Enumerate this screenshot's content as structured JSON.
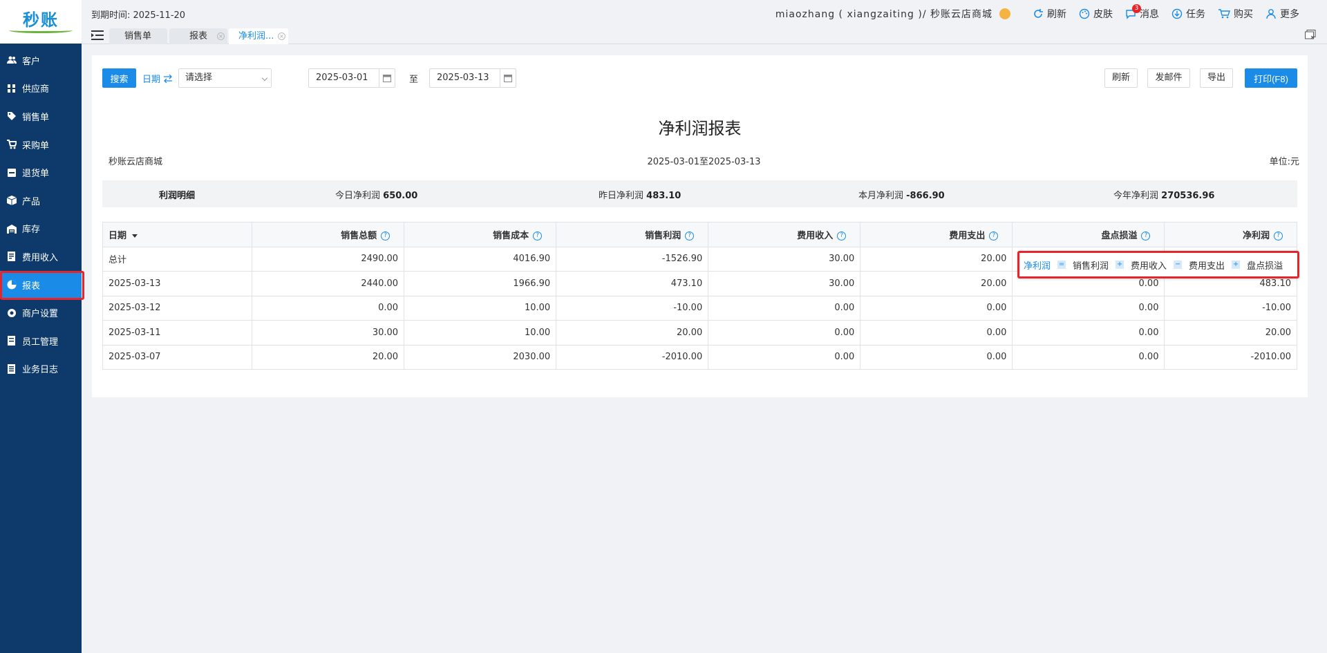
{
  "app": {
    "logo_text": "秒账",
    "expire_label": "到期时间: 2025-11-20",
    "user": "miaozhang ( xiangzaiting )/ 秒账云店商城",
    "toolbar": [
      {
        "label": "刷新",
        "icon": "refresh-icon"
      },
      {
        "label": "皮肤",
        "icon": "palette-icon"
      },
      {
        "label": "消息",
        "icon": "message-icon",
        "badge": "3"
      },
      {
        "label": "任务",
        "icon": "download-icon"
      },
      {
        "label": "购买",
        "icon": "cart-icon"
      },
      {
        "label": "更多",
        "icon": "user-icon"
      }
    ]
  },
  "sidebar": {
    "items": [
      {
        "label": "客户",
        "icon": "customer-icon"
      },
      {
        "label": "供应商",
        "icon": "supplier-icon"
      },
      {
        "label": "销售单",
        "icon": "tag-icon"
      },
      {
        "label": "采购单",
        "icon": "cart-icon"
      },
      {
        "label": "退货单",
        "icon": "return-icon"
      },
      {
        "label": "产品",
        "icon": "box-icon"
      },
      {
        "label": "库存",
        "icon": "warehouse-icon"
      },
      {
        "label": "费用收入",
        "icon": "ledger-icon"
      },
      {
        "label": "报表",
        "icon": "pie-chart-icon",
        "active": true
      },
      {
        "label": "商户设置",
        "icon": "settings-icon"
      },
      {
        "label": "员工管理",
        "icon": "staff-icon"
      },
      {
        "label": "业务日志",
        "icon": "log-icon"
      }
    ]
  },
  "tabs": [
    {
      "label": "销售单",
      "active": false,
      "closable": false
    },
    {
      "label": "报表",
      "active": false,
      "closable": true
    },
    {
      "label": "净利润...",
      "active": true,
      "closable": true
    }
  ],
  "filters": {
    "search_label": "搜索",
    "date_toggle_label": "日期",
    "select_placeholder": "请选择",
    "date_from": "2025-03-01",
    "to_label": "至",
    "date_to": "2025-03-13",
    "refresh_label": "刷新",
    "email_label": "发邮件",
    "export_label": "导出",
    "print_label": "打印(F8)"
  },
  "report": {
    "title": "净利润报表",
    "company": "秒账云店商城",
    "range": "2025-03-01至2025-03-13",
    "unit": "单位:元"
  },
  "summary": {
    "label": "利润明细",
    "today_label": "今日净利润",
    "today_value": "650.00",
    "yesterday_label": "昨日净利润",
    "yesterday_value": "483.10",
    "month_label": "本月净利润",
    "month_value": "-866.90",
    "year_label": "今年净利润",
    "year_value": "270536.96"
  },
  "table": {
    "headers": [
      "日期",
      "销售总额",
      "销售成本",
      "销售利润",
      "费用收入",
      "费用支出",
      "盘点损溢",
      "净利润"
    ],
    "rows": [
      [
        "总计",
        "2490.00",
        "4016.90",
        "-1526.90",
        "30.00",
        "20.00",
        "",
        ""
      ],
      [
        "2025-03-13",
        "2440.00",
        "1966.90",
        "473.10",
        "30.00",
        "20.00",
        "0.00",
        "483.10"
      ],
      [
        "2025-03-12",
        "0.00",
        "10.00",
        "-10.00",
        "0.00",
        "0.00",
        "0.00",
        "-10.00"
      ],
      [
        "2025-03-11",
        "30.00",
        "10.00",
        "20.00",
        "0.00",
        "0.00",
        "0.00",
        "20.00"
      ],
      [
        "2025-03-07",
        "20.00",
        "2030.00",
        "-2010.00",
        "0.00",
        "0.00",
        "0.00",
        "-2010.00"
      ]
    ]
  },
  "formula_tooltip": {
    "result": "净利润",
    "eq": "=",
    "term1": "销售利润",
    "plus1": "+",
    "term2": "费用收入",
    "minus": "−",
    "term3": "费用支出",
    "plus2": "+",
    "term4": "盘点损溢"
  },
  "colors": {
    "sidebar_bg": "#0d3a6b",
    "accent": "#1a8ce8",
    "highlight_border": "#e8232a"
  }
}
